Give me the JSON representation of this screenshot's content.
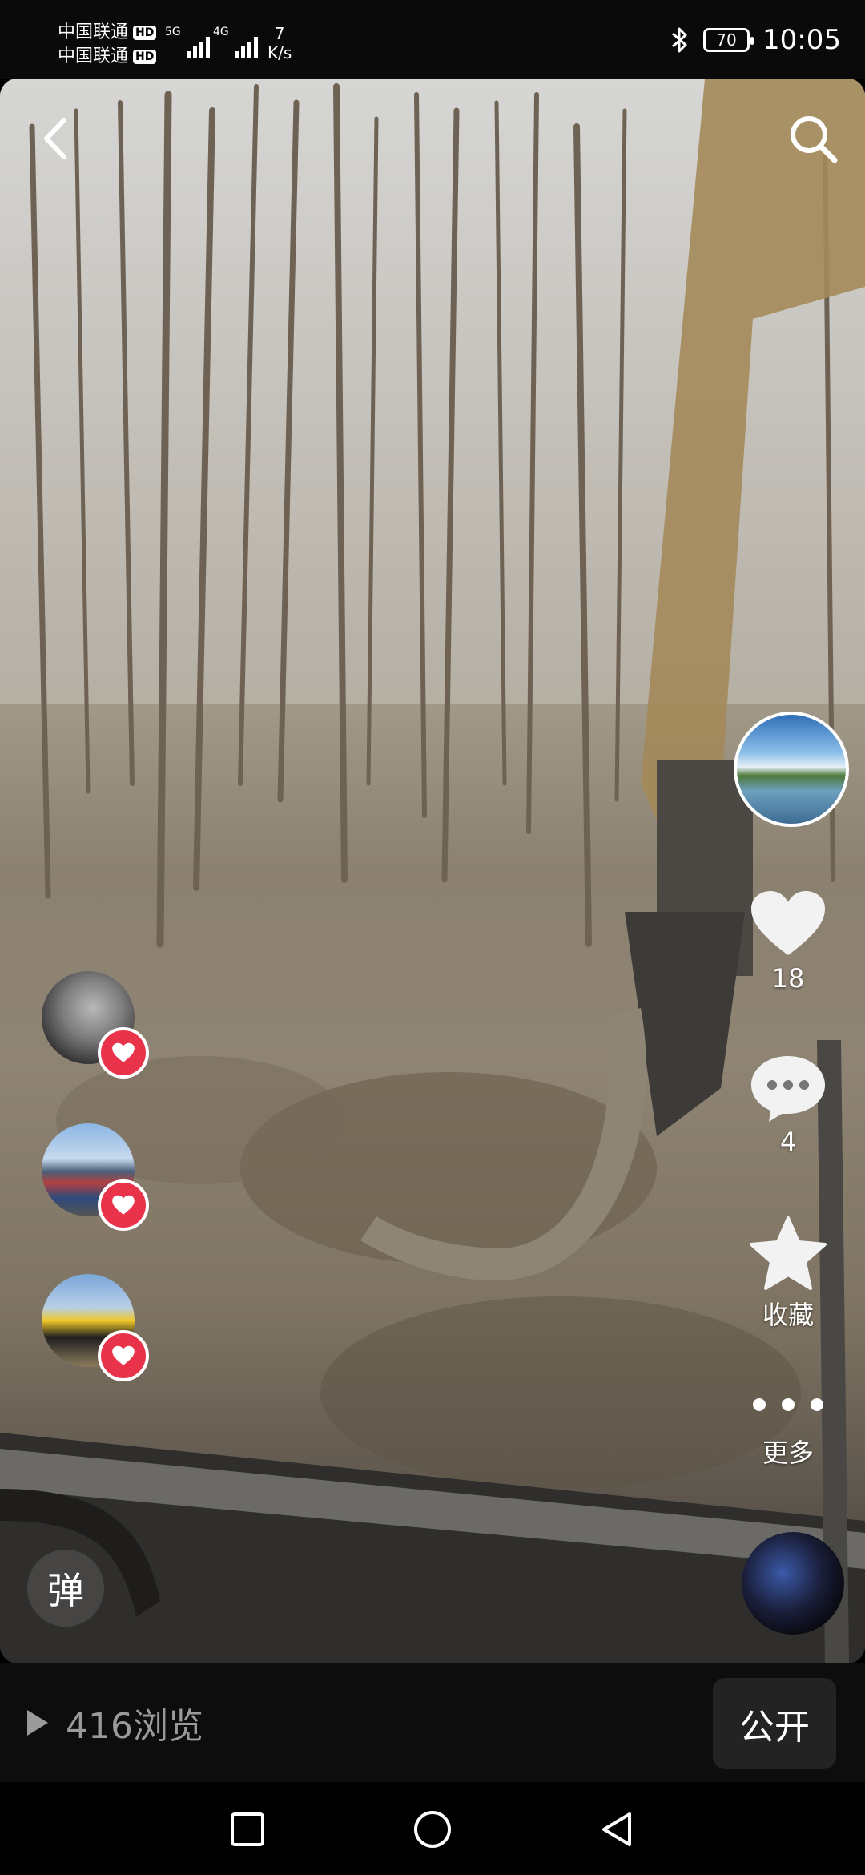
{
  "status_bar": {
    "carrier1": "中国联通",
    "carrier2": "中国联通",
    "hd": "HD",
    "net1": "5G",
    "net2": "4G",
    "speed_value": "7",
    "speed_unit": "K/s",
    "battery": "70",
    "time": "10:05"
  },
  "icons": {
    "back": "chevron-left-icon",
    "search": "search-icon",
    "like": "heart-icon",
    "comment": "comment-bubble-icon",
    "favorite": "star-icon",
    "more": "more-dots-icon",
    "play": "play-icon"
  },
  "side_actions": {
    "like_count": "18",
    "comment_count": "4",
    "favorite_label": "收藏",
    "more_label": "更多"
  },
  "danmu_label": "弹",
  "footer": {
    "views": "416浏览",
    "visibility_button": "公开"
  },
  "colors": {
    "accent_heart": "#e8334a",
    "background": "#000000"
  }
}
